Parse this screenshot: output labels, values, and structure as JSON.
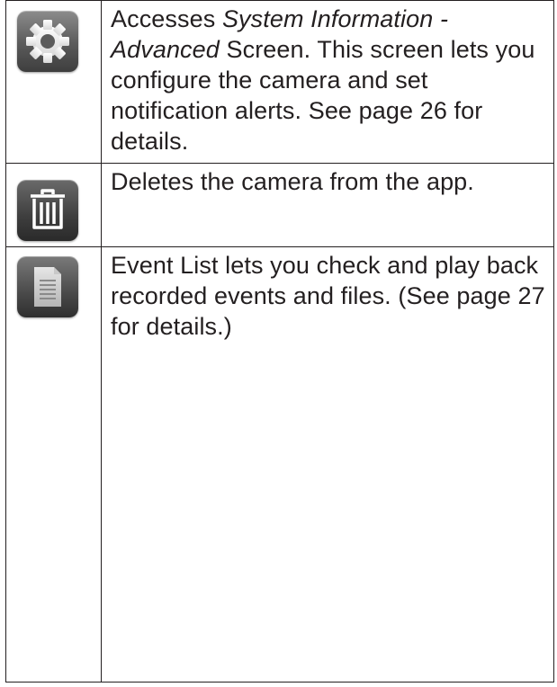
{
  "rows": [
    {
      "icon": "gear-icon",
      "text_prefix": "Accesses ",
      "text_italic": "System Information - Advanced",
      "text_suffix": " Screen. This screen lets you configure the camera and set notification alerts. See page 26 for details."
    },
    {
      "icon": "trash-icon",
      "text": "Deletes the camera from the app."
    },
    {
      "icon": "document-icon",
      "text": "Event List lets you check and play back recorded events and files. (See page 27 for details.)"
    }
  ]
}
